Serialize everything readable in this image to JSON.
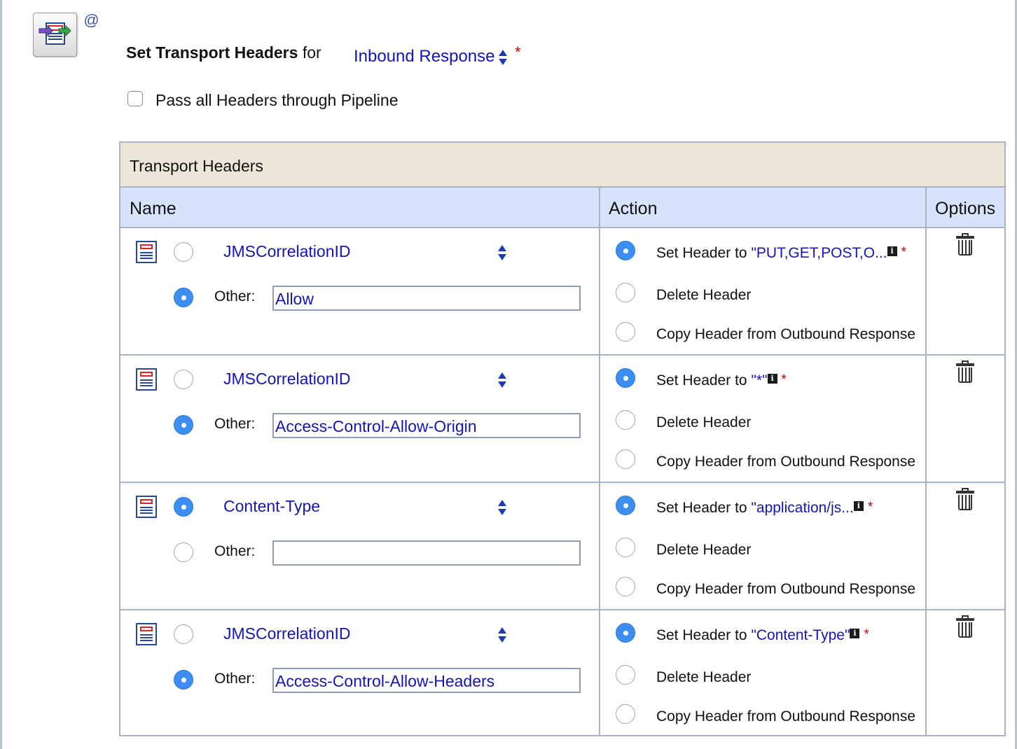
{
  "header": {
    "icons": {
      "action": "transport-headers-action-icon",
      "at": "at-sign-icon"
    },
    "title_bold": "Set Transport Headers",
    "title_for": "for",
    "direction_value": "Inbound Response",
    "required_mark": "*",
    "pass_all_label": "Pass all Headers through Pipeline",
    "pass_all_checked": false
  },
  "table": {
    "title": "Transport Headers",
    "columns": {
      "name": "Name",
      "action": "Action",
      "options": "Options"
    },
    "other_label": "Other:",
    "set_prefix": "Set Header to",
    "delete_label": "Delete Header",
    "copy_label": "Copy Header from Outbound Response",
    "info_glyph": "i",
    "rows": [
      {
        "header_name": "JMSCorrelationID",
        "name_mode": "other",
        "other_value": "Allow",
        "set_value": "\"PUT,GET,POST,O...",
        "action": "set"
      },
      {
        "header_name": "JMSCorrelationID",
        "name_mode": "other",
        "other_value": "Access-Control-Allow-Origin",
        "set_value": "\"*\"",
        "action": "set"
      },
      {
        "header_name": "Content-Type",
        "name_mode": "list",
        "other_value": "",
        "set_value": "\"application/js...",
        "action": "set"
      },
      {
        "header_name": "JMSCorrelationID",
        "name_mode": "other",
        "other_value": "Access-Control-Allow-Headers",
        "set_value": "\"Content-Type\"",
        "action": "set"
      }
    ]
  },
  "colors": {
    "link": "#1414b8",
    "required": "#cc0000",
    "radio_on": "#3c8ff0",
    "table_title_bg": "#ebe6d7",
    "column_header_bg": "#d6e3fa"
  }
}
